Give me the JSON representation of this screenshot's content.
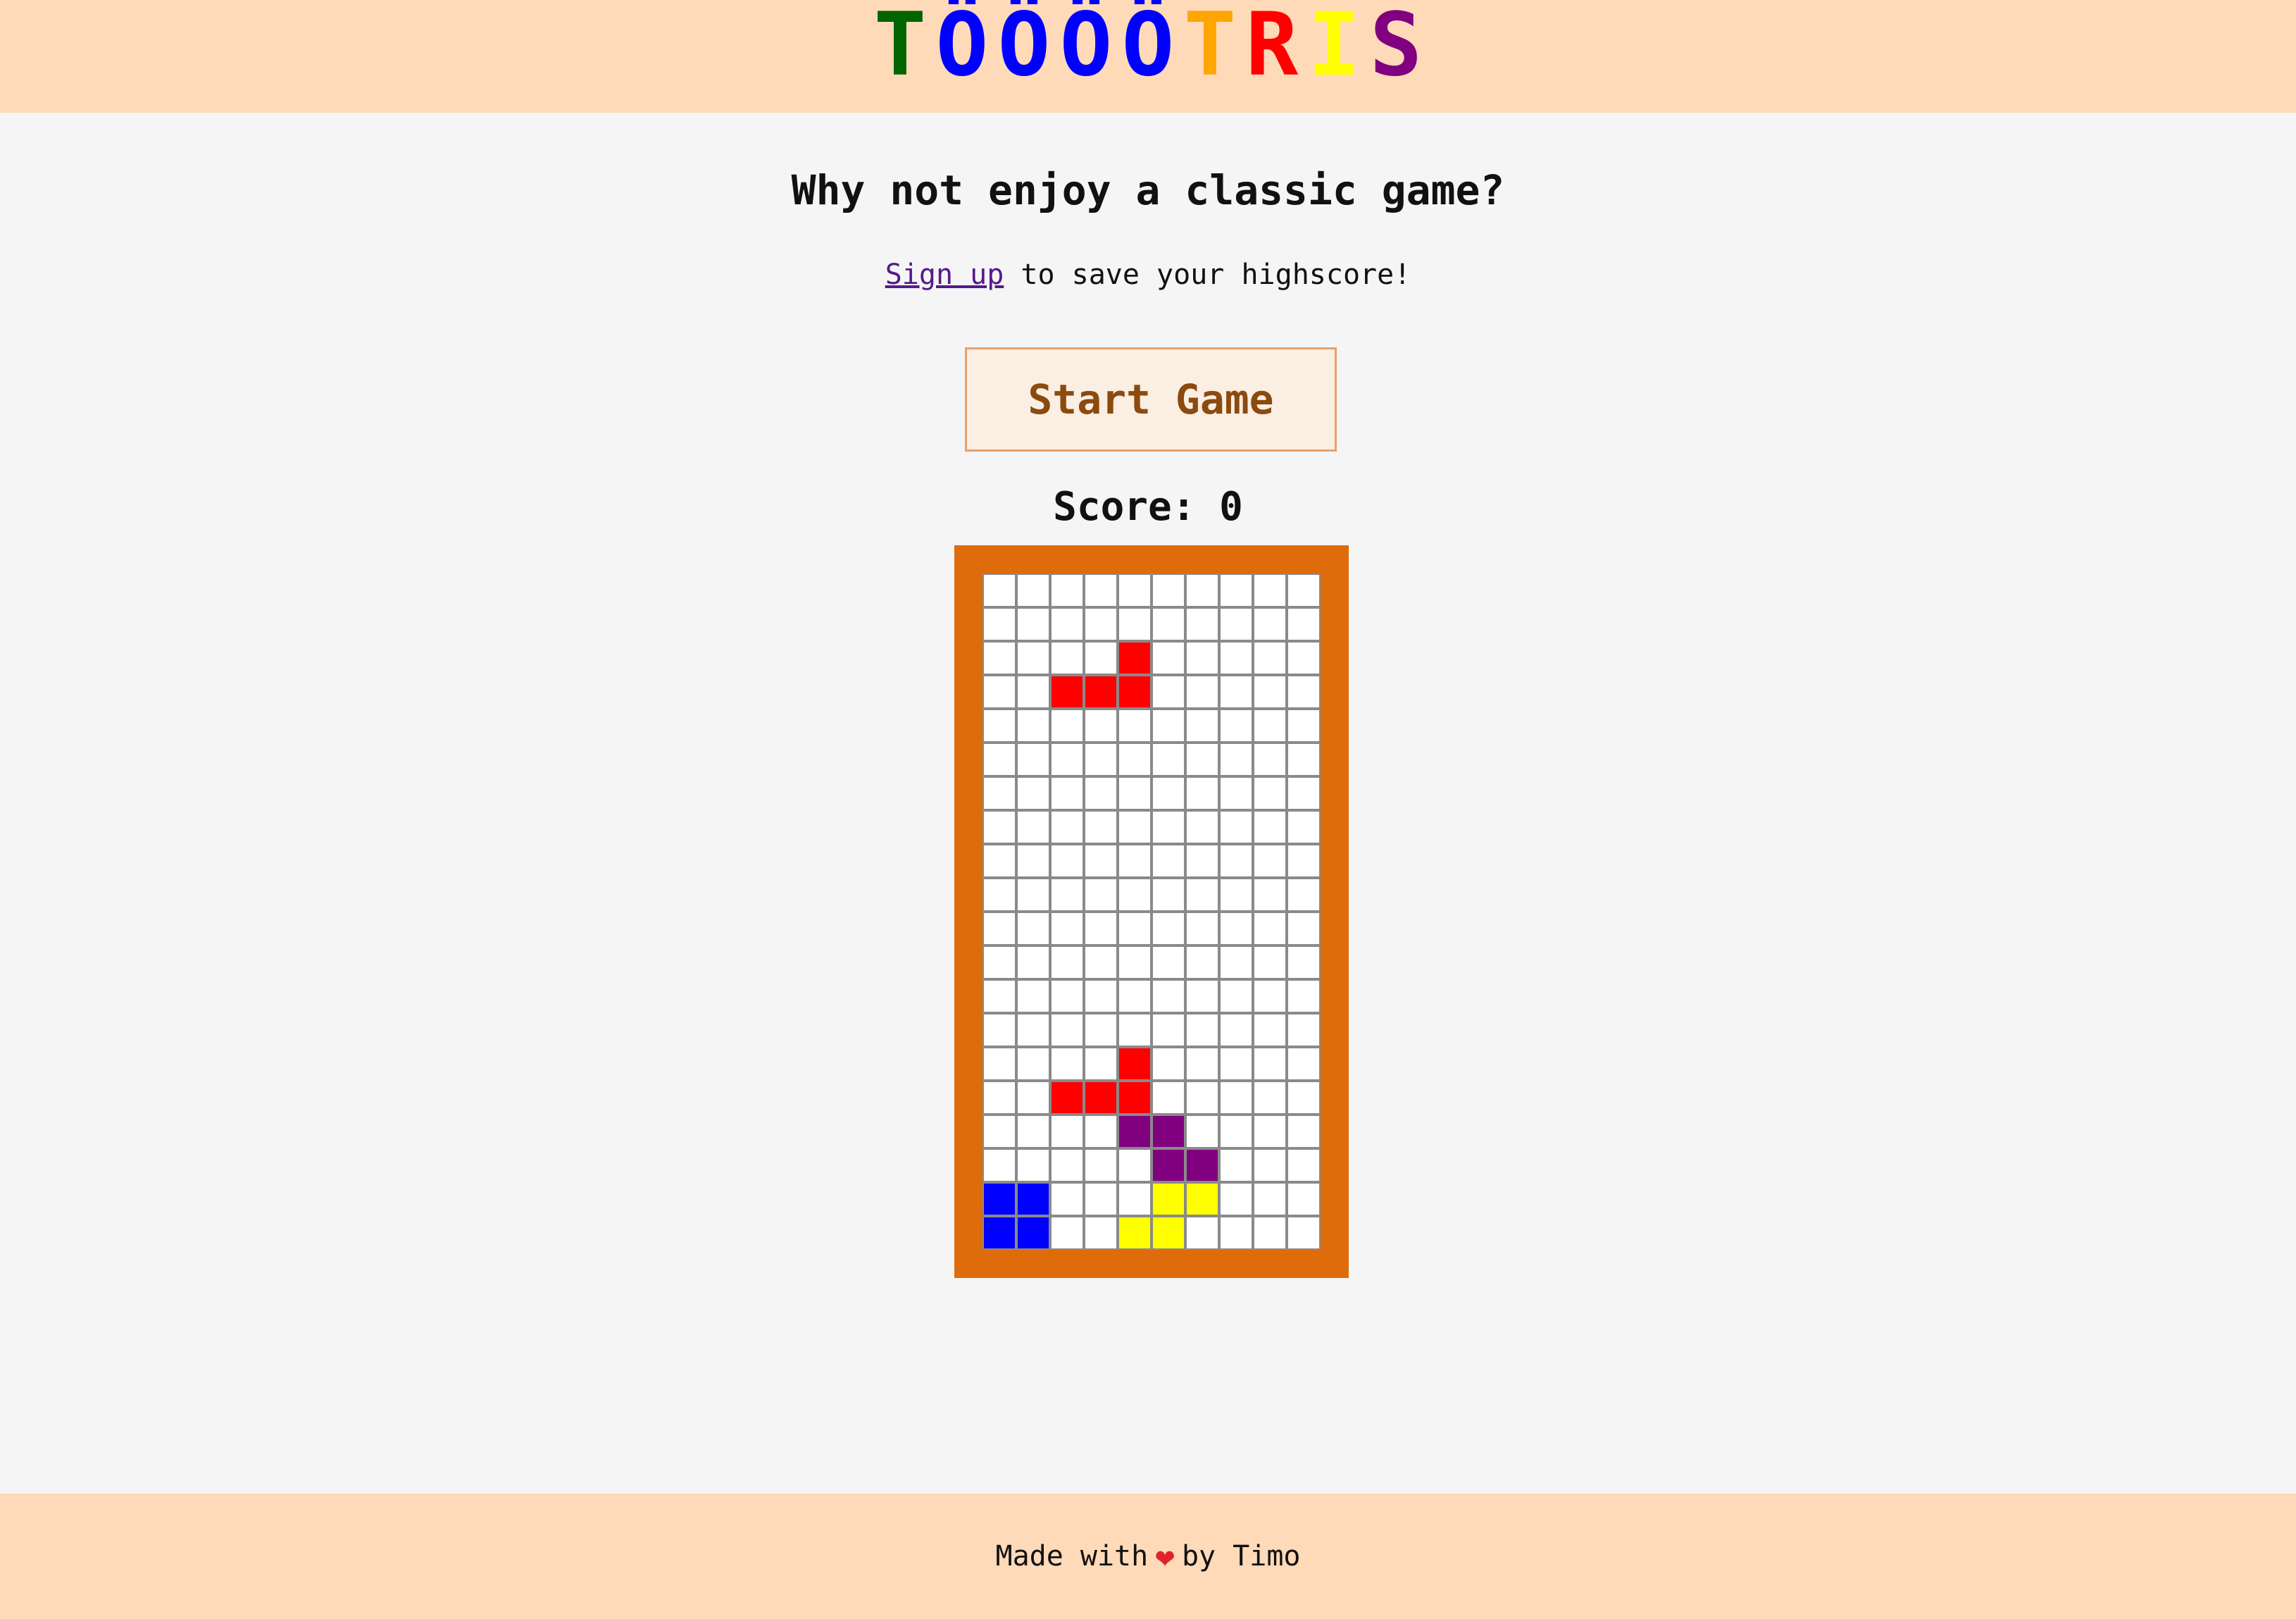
{
  "header": {
    "logo_letters": [
      {
        "char": "T",
        "color": "#006400"
      },
      {
        "char": "Ö",
        "color": "#0000ff"
      },
      {
        "char": "Ö",
        "color": "#0000ff"
      },
      {
        "char": "Ö",
        "color": "#0000ff"
      },
      {
        "char": "Ö",
        "color": "#0000ff"
      },
      {
        "char": "T",
        "color": "#ffa500"
      },
      {
        "char": "R",
        "color": "#ff0000"
      },
      {
        "char": "I",
        "color": "#ffff00"
      },
      {
        "char": "S",
        "color": "#800080"
      }
    ]
  },
  "main": {
    "headline": "Why not enjoy a classic game?",
    "signup_link": "Sign up",
    "signup_rest": " to save your highscore!",
    "start_button": "Start Game",
    "score_text": "Score: 0"
  },
  "board": {
    "cols": 10,
    "rows": 20,
    "empty_color": "#ffffff",
    "filled": [
      {
        "row": 2,
        "col": 4,
        "color": "#ff0000"
      },
      {
        "row": 3,
        "col": 2,
        "color": "#ff0000"
      },
      {
        "row": 3,
        "col": 3,
        "color": "#ff0000"
      },
      {
        "row": 3,
        "col": 4,
        "color": "#ff0000"
      },
      {
        "row": 14,
        "col": 4,
        "color": "#ff0000"
      },
      {
        "row": 15,
        "col": 2,
        "color": "#ff0000"
      },
      {
        "row": 15,
        "col": 3,
        "color": "#ff0000"
      },
      {
        "row": 15,
        "col": 4,
        "color": "#ff0000"
      },
      {
        "row": 16,
        "col": 4,
        "color": "#800080"
      },
      {
        "row": 16,
        "col": 5,
        "color": "#800080"
      },
      {
        "row": 17,
        "col": 5,
        "color": "#800080"
      },
      {
        "row": 17,
        "col": 6,
        "color": "#800080"
      },
      {
        "row": 18,
        "col": 0,
        "color": "#0000ff"
      },
      {
        "row": 18,
        "col": 1,
        "color": "#0000ff"
      },
      {
        "row": 19,
        "col": 0,
        "color": "#0000ff"
      },
      {
        "row": 19,
        "col": 1,
        "color": "#0000ff"
      },
      {
        "row": 18,
        "col": 5,
        "color": "#ffff00"
      },
      {
        "row": 18,
        "col": 6,
        "color": "#ffff00"
      },
      {
        "row": 19,
        "col": 4,
        "color": "#ffff00"
      },
      {
        "row": 19,
        "col": 5,
        "color": "#ffff00"
      }
    ]
  },
  "footer": {
    "made_with": "Made with",
    "heart": "❤",
    "by": "by Timo"
  }
}
